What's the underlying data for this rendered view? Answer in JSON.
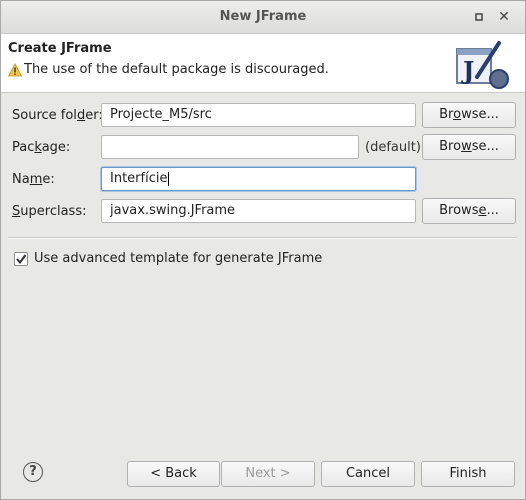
{
  "window": {
    "title": "New JFrame"
  },
  "header": {
    "title": "Create JFrame",
    "message": "The use of the default package is discouraged."
  },
  "form": {
    "source_folder": {
      "label_pre": "Source fol",
      "label_u": "d",
      "label_post": "er:",
      "value": "Projecte_M5/src",
      "browse": "Browse..."
    },
    "package": {
      "label_pre": "Pac",
      "label_u": "k",
      "label_post": "age:",
      "value": "",
      "hint": "(default)",
      "browse": "Browse..."
    },
    "name": {
      "label_pre": "Na",
      "label_u": "m",
      "label_post": "e:",
      "value": "Interfície"
    },
    "superclass": {
      "label_pre": "",
      "label_u": "S",
      "label_post": "uperclass:",
      "value": "javax.swing.JFrame",
      "browse": "Browse..."
    },
    "advanced_template": {
      "label": "Use advanced template for generate JFrame",
      "checked": true
    }
  },
  "footer": {
    "back": "< Back",
    "next": "Next >",
    "cancel": "Cancel",
    "finish": "Finish"
  }
}
